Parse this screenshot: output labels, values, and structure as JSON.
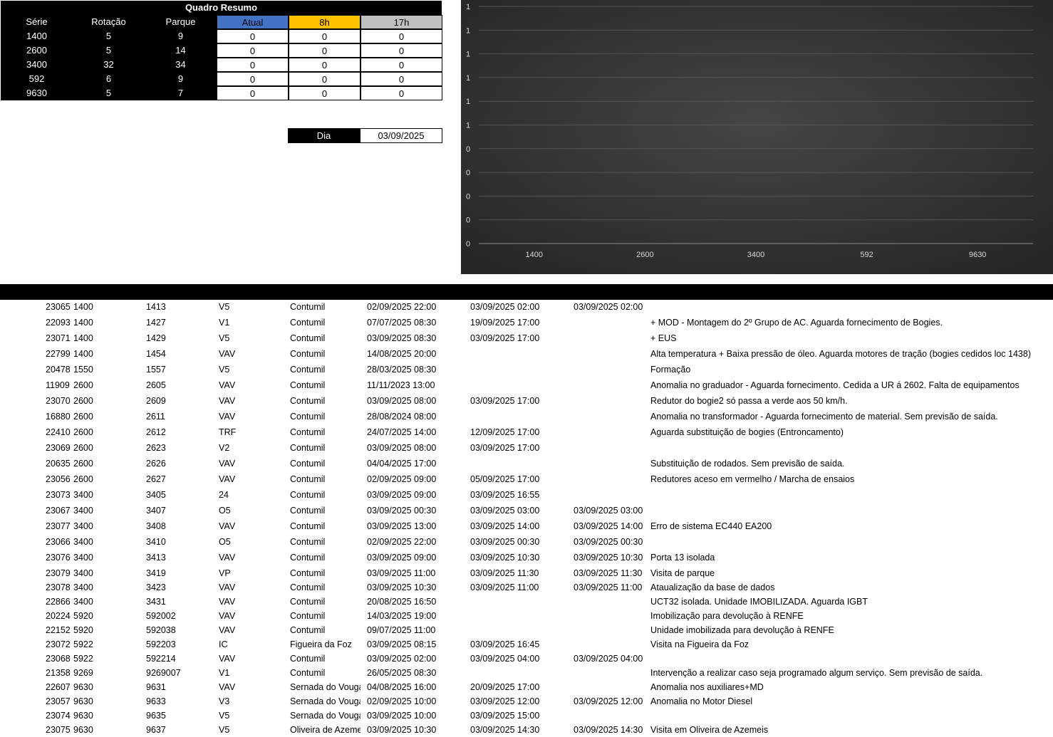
{
  "summary": {
    "title": "Quadro Resumo",
    "headers": [
      "Série",
      "Rotação",
      "Parque",
      "Atual",
      "8h",
      "17h"
    ],
    "rows": [
      [
        "1400",
        "5",
        "9",
        "0",
        "0",
        "0"
      ],
      [
        "2600",
        "5",
        "14",
        "0",
        "0",
        "0"
      ],
      [
        "3400",
        "32",
        "34",
        "0",
        "0",
        "0"
      ],
      [
        "592",
        "6",
        "9",
        "0",
        "0",
        "0"
      ],
      [
        "9630",
        "5",
        "7",
        "0",
        "0",
        "0"
      ]
    ],
    "colors": {
      "atual": "#4472c4",
      "h8": "#ffc000",
      "h17": "#bfbfbf"
    }
  },
  "dia": {
    "label": "Dia",
    "value": "03/09/2025"
  },
  "chart_data": {
    "type": "bar",
    "categories": [
      "1400",
      "2600",
      "3400",
      "592",
      "9630"
    ],
    "series": [
      {
        "values": [
          0,
          0,
          0,
          0,
          0
        ]
      }
    ],
    "ytick_labels": [
      "1",
      "1",
      "1",
      "1",
      "1",
      "1",
      "0",
      "0",
      "0",
      "0",
      "0"
    ],
    "grid": true,
    "background": "#2e2e2e"
  },
  "records": [
    [
      "23065",
      "1400",
      "1413",
      "V5",
      "Contumil",
      "02/09/2025 22:00",
      "03/09/2025 02:00",
      "03/09/2025 02:00",
      ""
    ],
    [
      "22093",
      "1400",
      "1427",
      "V1",
      "Contumil",
      "07/07/2025 08:30",
      "19/09/2025 17:00",
      "",
      "+ MOD - Montagem do 2º Grupo de AC. Aguarda fornecimento de Bogies."
    ],
    [
      "23071",
      "1400",
      "1429",
      "V5",
      "Contumil",
      "03/09/2025 08:30",
      "03/09/2025 17:00",
      "",
      "+ EUS"
    ],
    [
      "22799",
      "1400",
      "1454",
      "VAV",
      "Contumil",
      "14/08/2025 20:00",
      "",
      "",
      "Alta temperatura + Baixa pressão de óleo. Aguarda motores de tração (bogies cedidos loc 1438)"
    ],
    [
      "20478",
      "1550",
      "1557",
      "V5",
      "Contumil",
      "28/03/2025 08:30",
      "",
      "",
      "Formação"
    ],
    [
      "11909",
      "2600",
      "2605",
      "VAV",
      "Contumil",
      "11/11/2023 13:00",
      "",
      "",
      "Anomalia no graduador - Aguarda fornecimento. Cedida a UR á 2602. Falta de equipamentos"
    ],
    [
      "23070",
      "2600",
      "2609",
      "VAV",
      "Contumil",
      "03/09/2025 08:00",
      "03/09/2025 17:00",
      "",
      "Redutor do bogie2 só passa a verde aos 50 km/h."
    ],
    [
      "16880",
      "2600",
      "2611",
      "VAV",
      "Contumil",
      "28/08/2024 08:00",
      "",
      "",
      "Anomalia no transformador - Aguarda fornecimento de material. Sem previsão de saída."
    ],
    [
      "22410",
      "2600",
      "2612",
      "TRF",
      "Contumil",
      "24/07/2025 14:00",
      "12/09/2025 17:00",
      "",
      "Aguarda substituição de bogies (Entroncamento)"
    ],
    [
      "23069",
      "2600",
      "2623",
      "V2",
      "Contumil",
      "03/09/2025 08:00",
      "03/09/2025 17:00",
      "",
      ""
    ],
    [
      "20635",
      "2600",
      "2626",
      "VAV",
      "Contumil",
      "04/04/2025 17:00",
      "",
      "",
      "Substituição de rodados. Sem previsão de saída."
    ],
    [
      "23056",
      "2600",
      "2627",
      "VAV",
      "Contumil",
      "02/09/2025 09:00",
      "05/09/2025 17:00",
      "",
      "Redutores aceso em vermelho / Marcha de ensaios"
    ],
    [
      "23073",
      "3400",
      "3405",
      "24",
      "Contumil",
      "03/09/2025 09:00",
      "03/09/2025 16:55",
      "",
      ""
    ],
    [
      "23067",
      "3400",
      "3407",
      "O5",
      "Contumil",
      "03/09/2025 00:30",
      "03/09/2025 03:00",
      "03/09/2025 03:00",
      ""
    ],
    [
      "23077",
      "3400",
      "3408",
      "VAV",
      "Contumil",
      "03/09/2025 13:00",
      "03/09/2025 14:00",
      "03/09/2025 14:00",
      "Erro de sistema EC440 EA200"
    ],
    [
      "23066",
      "3400",
      "3410",
      "O5",
      "Contumil",
      "02/09/2025 22:00",
      "03/09/2025 00:30",
      "03/09/2025 00:30",
      ""
    ],
    [
      "23076",
      "3400",
      "3413",
      "VAV",
      "Contumil",
      "03/09/2025 09:00",
      "03/09/2025 10:30",
      "03/09/2025 10:30",
      "Porta 13 isolada"
    ],
    [
      "23079",
      "3400",
      "3419",
      "VP",
      "Contumil",
      "03/09/2025 11:00",
      "03/09/2025 11:30",
      "03/09/2025 11:30",
      "Visita de parque"
    ],
    [
      "23078",
      "3400",
      "3423",
      "VAV",
      "Contumil",
      "03/09/2025 10:30",
      "03/09/2025 11:00",
      "03/09/2025 11:00",
      "Ataualização da base de dados"
    ],
    [
      "22866",
      "3400",
      "3431",
      "VAV",
      "Contumil",
      "20/08/2025 16:50",
      "",
      "",
      "UCT32 isolada. Unidade IMOBILIZADA. Aguarda IGBT"
    ],
    [
      "20224",
      "5920",
      "592002",
      "VAV",
      "Contumil",
      "14/03/2025 19:00",
      "",
      "",
      "Imobilização para devolução à RENFE"
    ],
    [
      "22152",
      "5920",
      "592038",
      "VAV",
      "Contumil",
      "09/07/2025 11:00",
      "",
      "",
      "Unidade imobilizada para devolução à RENFE"
    ],
    [
      "23072",
      "5922",
      "592203",
      "IC",
      "Figueira da Foz",
      "03/09/2025 08:15",
      "03/09/2025 16:45",
      "",
      "Visita na Figueira da Foz"
    ],
    [
      "23068",
      "5922",
      "592214",
      "VAV",
      "Contumil",
      "03/09/2025 02:00",
      "03/09/2025 04:00",
      "03/09/2025 04:00",
      ""
    ],
    [
      "21358",
      "9269",
      "9269007",
      "V1",
      "Contumil",
      "26/05/2025 08:30",
      "",
      "",
      "Intervenção a realizar caso seja programado algum serviço. Sem previsão de saída."
    ],
    [
      "22607",
      "9630",
      "9631",
      "VAV",
      "Sernada do Vouga",
      "04/08/2025 16:00",
      "20/09/2025 17:00",
      "",
      "Anomalia nos auxiliares+MD"
    ],
    [
      "23057",
      "9630",
      "9633",
      "V3",
      "Sernada do Vouga",
      "02/09/2025 10:00",
      "03/09/2025 12:00",
      "03/09/2025 12:00",
      "Anomalia no Motor Diesel"
    ],
    [
      "23074",
      "9630",
      "9635",
      "V5",
      "Sernada do Vouga",
      "03/09/2025 10:00",
      "03/09/2025 15:00",
      "",
      ""
    ],
    [
      "23075",
      "9630",
      "9637",
      "V5",
      "Oliveira de Azemeis",
      "03/09/2025 10:30",
      "03/09/2025 14:30",
      "03/09/2025 14:30",
      "Visita em Oliveira de Azemeis"
    ]
  ]
}
